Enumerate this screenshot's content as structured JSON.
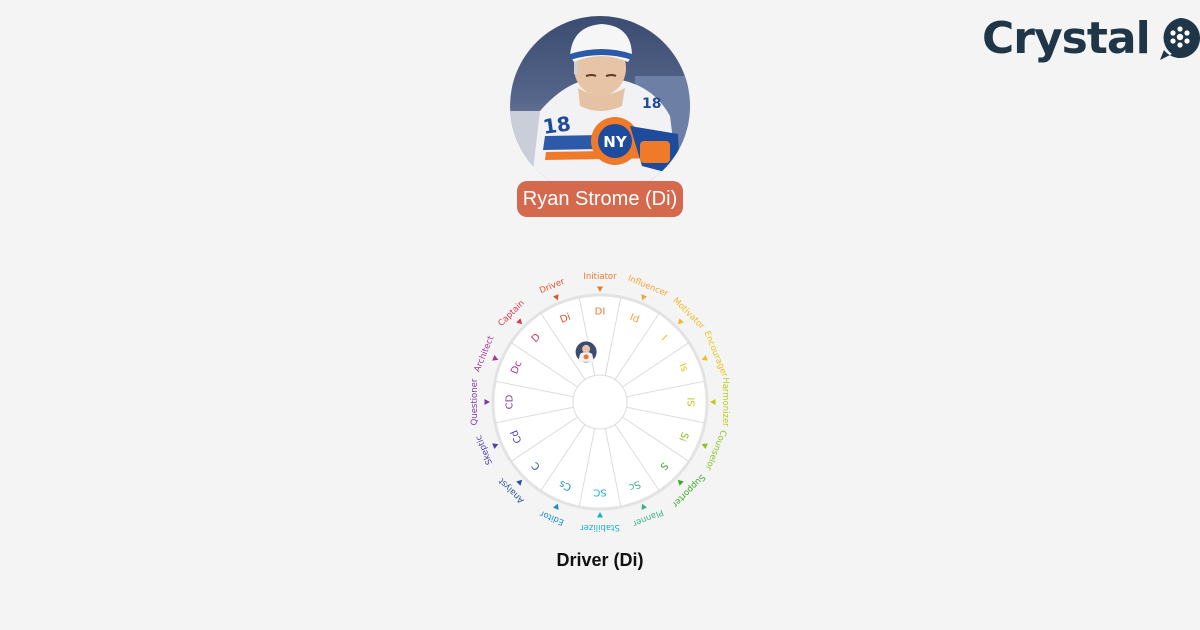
{
  "brand": {
    "name": "Crystal",
    "logo_icon": "crystal-flower-chat-icon",
    "color": "#1f3548"
  },
  "profile": {
    "name_label": "Ryan Strome (Di)",
    "pill_color": "#d4694e",
    "photo": "hockey-player-portrait"
  },
  "disc_wheel": {
    "selected_code": "Di",
    "segments": [
      {
        "code": "DI",
        "type": "Initiator",
        "color": "#e97a2c"
      },
      {
        "code": "Id",
        "type": "Influencer",
        "color": "#f4a23a"
      },
      {
        "code": "I",
        "type": "Motivator",
        "color": "#f2b824"
      },
      {
        "code": "Is",
        "type": "Encourager",
        "color": "#e3c51d"
      },
      {
        "code": "IS",
        "type": "Harmonizer",
        "color": "#bccb1c"
      },
      {
        "code": "Si",
        "type": "Counselor",
        "color": "#8cc21f"
      },
      {
        "code": "S",
        "type": "Supporter",
        "color": "#3daa27"
      },
      {
        "code": "Sc",
        "type": "Planner",
        "color": "#3faf8b"
      },
      {
        "code": "SC",
        "type": "Stabilizer",
        "color": "#1bb0c4"
      },
      {
        "code": "Cs",
        "type": "Editor",
        "color": "#1a8fc3"
      },
      {
        "code": "C",
        "type": "Analyst",
        "color": "#25519d"
      },
      {
        "code": "Cd",
        "type": "Skeptic",
        "color": "#5241a8"
      },
      {
        "code": "CD",
        "type": "Questioner",
        "color": "#7b3aa6"
      },
      {
        "code": "Dc",
        "type": "Architect",
        "color": "#a83593"
      },
      {
        "code": "D",
        "type": "Captain",
        "color": "#d23a52"
      },
      {
        "code": "Di",
        "type": "Driver",
        "color": "#e1542f"
      }
    ]
  },
  "result": {
    "label": "Driver (Di)"
  }
}
